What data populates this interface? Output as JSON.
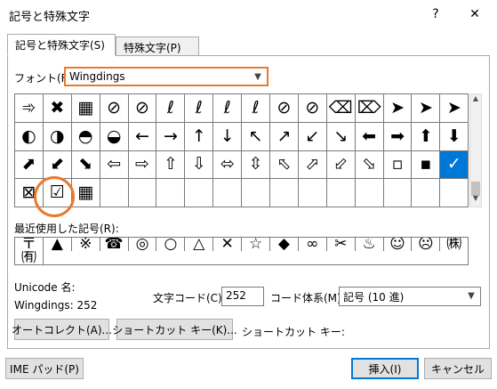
{
  "window": {
    "title": "記号と特殊文字",
    "help": "?",
    "close": "✕"
  },
  "tabs": [
    {
      "label": "記号と特殊文字(S)"
    },
    {
      "label": "特殊文字(P)"
    }
  ],
  "font": {
    "label": "フォント(F):",
    "value": "Wingdings"
  },
  "symbols": [
    "➾",
    "✖",
    "▦",
    "⊘",
    "⊘",
    "ℓ",
    "ℓ",
    "ℓ",
    "ℓ",
    "⊘",
    "⊘",
    "⌫",
    "⌦",
    "➤",
    "➤",
    "➤",
    "◐",
    "◑",
    "◓",
    "◒",
    "←",
    "→",
    "↑",
    "↓",
    "↖",
    "↗",
    "↙",
    "↘",
    "⬅",
    "➡",
    "⬆",
    "⬇",
    "⬈",
    "⬋",
    "⬊",
    "⇦",
    "⇨",
    "⇧",
    "⇩",
    "⬄",
    "⇳",
    "⬁",
    "⬀",
    "⬃",
    "⬂",
    "▫",
    "▪",
    "✕",
    "⊠",
    "☑",
    "▦",
    "",
    "",
    "",
    "",
    "",
    "",
    "",
    "",
    "",
    "",
    "",
    "",
    ""
  ],
  "selected_symbol": "✓",
  "recent": {
    "label": "最近使用した記号(R):",
    "items": [
      "〒",
      "▲",
      "※",
      "☎",
      "◎",
      "○",
      "△",
      "✕",
      "☆",
      "◆",
      "∞",
      "✂",
      "♨",
      "☺",
      "☹",
      "㈱",
      "㈲"
    ]
  },
  "unicode": {
    "label": "Unicode 名:",
    "value": "Wingdings: 252"
  },
  "char_code": {
    "label": "文字コード(C):",
    "value": "252"
  },
  "code_system": {
    "label": "コード体系(M):",
    "value": "記号 (10 進)"
  },
  "buttons": {
    "autocorrect": "オートコレクト(A)...",
    "shortcut": "ショートカット キー(K)...",
    "shortcut_label": "ショートカット キー:",
    "ime": "IME パッド(P)",
    "insert": "挿入(I)",
    "cancel": "キャンセル"
  },
  "colors": {
    "accent": "#0078d7",
    "highlight": "#e87a2e"
  }
}
